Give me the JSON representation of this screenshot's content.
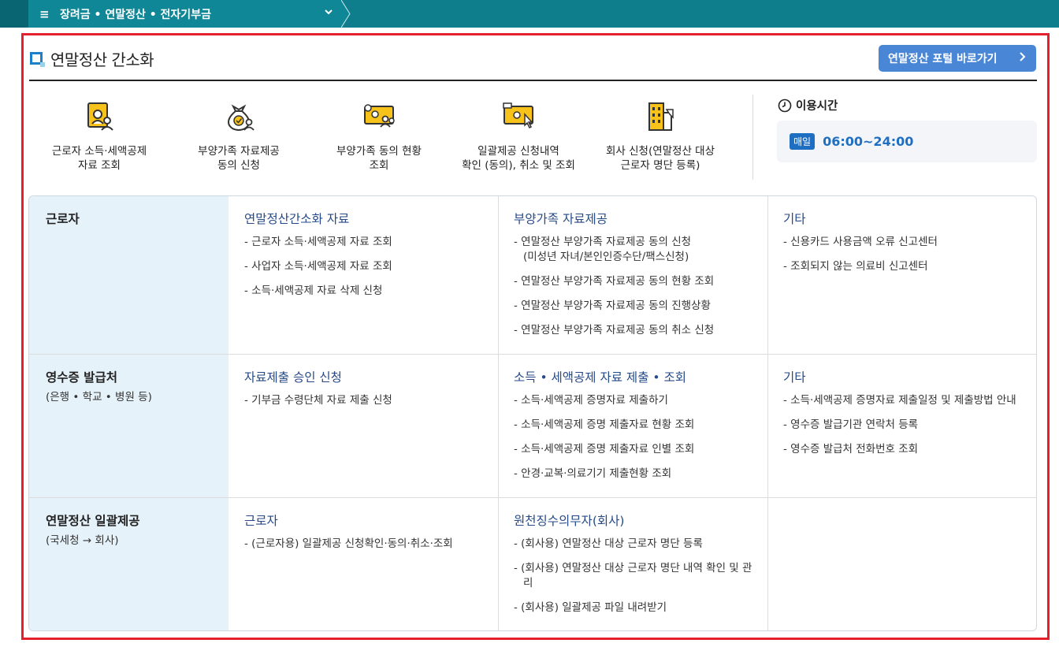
{
  "breadcrumb": {
    "label": "장려금 • 연말정산 • 전자기부금"
  },
  "header": {
    "title": "연말정산 간소화",
    "portal_button": "연말정산 포털 바로가기"
  },
  "services": [
    {
      "line1": "근로자 소득·세액공제",
      "line2": "자료 조회",
      "icon": "document-user-icon"
    },
    {
      "line1": "부양가족 자료제공",
      "line2": "동의 신청",
      "icon": "money-bag-check-icon"
    },
    {
      "line1": "부양가족 동의 현황",
      "line2": "조회",
      "icon": "monitor-people-icon"
    },
    {
      "line1": "일괄제공 신청내역",
      "line2": "확인 (동의), 취소 및 조회",
      "icon": "monitor-cursor-icon"
    },
    {
      "line1": "회사 신청(연말정산 대상",
      "line2": "근로자 명단 등록)",
      "icon": "building-icon"
    }
  ],
  "usage": {
    "label": "이용시간",
    "badge": "매일",
    "hours": "06:00~24:00"
  },
  "rows": [
    {
      "title": "근로자",
      "subtitle": "",
      "cols": [
        {
          "title": "연말정산간소화 자료",
          "items": [
            "- 근로자 소득·세액공제 자료 조회",
            "- 사업자 소득·세액공제 자료 조회",
            "- 소득·세액공제 자료 삭제 신청"
          ]
        },
        {
          "title": "부양가족 자료제공",
          "items": [
            "- 연말정산 부양가족 자료제공 동의 신청",
            "- 연말정산 부양가족 자료제공 동의 현황 조회",
            "- 연말정산 부양가족 자료제공 동의 진행상황",
            "- 연말정산 부양가족 자료제공 동의 취소 신청"
          ],
          "item0_sub": "(미성년 자녀/본인인증수단/팩스신청)"
        },
        {
          "title": "기타",
          "items": [
            "- 신용카드 사용금액 오류 신고센터",
            "- 조회되지 않는 의료비 신고센터"
          ]
        }
      ]
    },
    {
      "title": "영수증 발급처",
      "subtitle": "(은행 • 학교 • 병원 등)",
      "cols": [
        {
          "title": "자료제출 승인 신청",
          "items": [
            "- 기부금 수령단체 자료 제출 신청"
          ]
        },
        {
          "title": "소득 • 세액공제 자료 제출 • 조회",
          "items": [
            "- 소득·세액공제 증명자료 제출하기",
            "- 소득·세액공제 증명 제출자료 현황 조회",
            "- 소득·세액공제 증명 제출자료 인별 조회",
            "- 안경·교복·의료기기 제출현황 조회"
          ]
        },
        {
          "title": "기타",
          "items": [
            "- 소득·세액공제 증명자료 제출일정 및 제출방법 안내",
            "- 영수증 발급기관 연락처 등록",
            "- 영수증 발급처 전화번호 조회"
          ]
        }
      ]
    },
    {
      "title": "연말정산 일괄제공",
      "subtitle": "(국세청 → 회사)",
      "cols": [
        {
          "title": "근로자",
          "items": [
            "- (근로자용) 일괄제공 신청확인·동의·취소·조회"
          ]
        },
        {
          "title": "원천징수의무자(회사)",
          "items": [
            "- (회사용) 연말정산 대상 근로자 명단 등록",
            "- (회사용) 연말정산 대상 근로자 명단 내역 확인 및 관리",
            "- (회사용) 일괄제공 파일 내려받기"
          ]
        },
        {
          "title": "",
          "items": []
        }
      ]
    }
  ]
}
